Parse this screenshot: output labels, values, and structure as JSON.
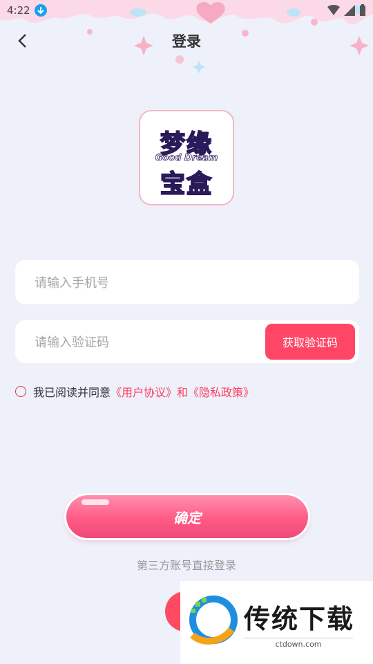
{
  "status_bar": {
    "time": "4:22"
  },
  "header": {
    "title": "登录"
  },
  "logo": {
    "line1": "梦缘",
    "english": "Good Dream",
    "line2": "宝盒"
  },
  "phone": {
    "placeholder": "请输入手机号"
  },
  "code": {
    "placeholder": "请输入验证码",
    "button_label": "获取验证码"
  },
  "agreement": {
    "prefix": "我已阅读并同意",
    "user_agreement": "《用户协议》",
    "and": "和",
    "privacy_policy": "《隐私政策》"
  },
  "confirm": {
    "label": "确定"
  },
  "third_party": {
    "label": "第三方账号直接登录"
  },
  "watermark": {
    "title": "传统下载",
    "url": "ctdown.com"
  },
  "colors": {
    "accent": "#ff4667",
    "link": "#ff3d63",
    "background": "#eef0fa"
  }
}
